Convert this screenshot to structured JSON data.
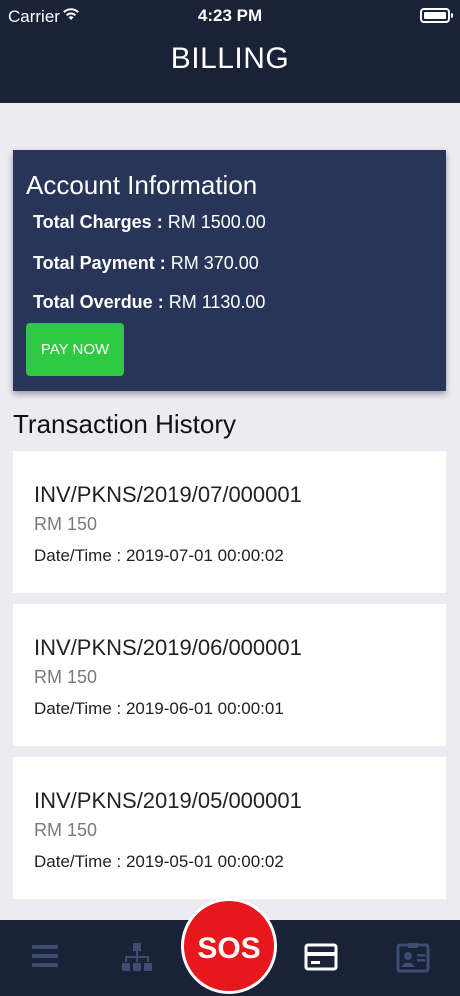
{
  "status_bar": {
    "carrier": "Carrier",
    "time": "4:23 PM"
  },
  "header": {
    "title": "BILLING"
  },
  "account": {
    "title": "Account Information",
    "rows": [
      {
        "label": "Total Charges :",
        "value": "RM 1500.00"
      },
      {
        "label": "Total Payment :",
        "value": "RM 370.00"
      },
      {
        "label": "Total Overdue :",
        "value": "RM 1130.00"
      }
    ],
    "pay_button": "PAY NOW"
  },
  "history": {
    "title": "Transaction History",
    "items": [
      {
        "invoice": "INV/PKNS/2019/07/000001",
        "amount": "RM 150",
        "datetime": "Date/Time : 2019-07-01 00:00:02"
      },
      {
        "invoice": "INV/PKNS/2019/06/000001",
        "amount": "RM 150",
        "datetime": "Date/Time : 2019-06-01 00:00:01"
      },
      {
        "invoice": "INV/PKNS/2019/05/000001",
        "amount": "RM 150",
        "datetime": "Date/Time : 2019-05-01 00:00:02"
      }
    ]
  },
  "tabbar": {
    "sos_label": "SOS",
    "icons": [
      "menu-icon",
      "sitemap-icon",
      "credit-card-icon",
      "contact-card-icon"
    ]
  },
  "colors": {
    "header_bg": "#1a2238",
    "card_bg": "#283558",
    "pay_green": "#2ecb42",
    "sos_red": "#e8171c"
  }
}
